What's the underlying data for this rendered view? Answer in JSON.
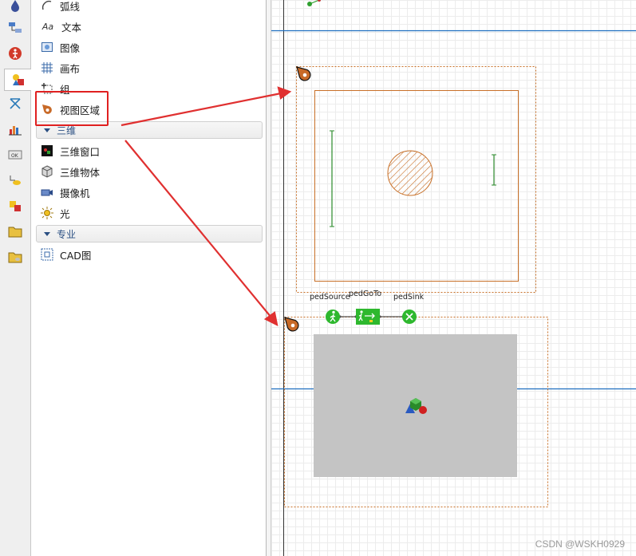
{
  "palette": {
    "items_top": [
      {
        "label": "弧线",
        "icon": "arc-icon"
      },
      {
        "label": "文本",
        "icon": "text-aa-icon",
        "prefix": "Aa"
      },
      {
        "label": "图像",
        "icon": "image-icon"
      },
      {
        "label": "画布",
        "icon": "canvas-grid-icon"
      },
      {
        "label": "组",
        "icon": "group-icon"
      },
      {
        "label": "视图区域",
        "icon": "viewarea-icon"
      }
    ],
    "section_3d": {
      "label": "三维"
    },
    "items_3d": [
      {
        "label": "三维窗口",
        "icon": "3d-window-icon"
      },
      {
        "label": "三维物体",
        "icon": "3d-object-icon"
      },
      {
        "label": "摄像机",
        "icon": "camera-icon"
      },
      {
        "label": "光",
        "icon": "light-icon"
      }
    ],
    "section_pro": {
      "label": "专业"
    },
    "items_pro": [
      {
        "label": "CAD图",
        "icon": "cad-icon"
      }
    ]
  },
  "canvas": {
    "blocks": [
      {
        "label": "pedSource",
        "icon": "walking-person-icon"
      },
      {
        "label": "pedGoTo",
        "icon": "person-arrow-icon"
      },
      {
        "label": "pedSink",
        "icon": "x-circle-icon"
      }
    ]
  },
  "watermark": "CSDN @WSKH0929",
  "colors": {
    "highlight_red": "#e02020",
    "arrow_red": "#e03030",
    "viewarea_orange": "#c87028",
    "axis_blue": "#1f6fc0",
    "block_green": "#2eb82e"
  }
}
